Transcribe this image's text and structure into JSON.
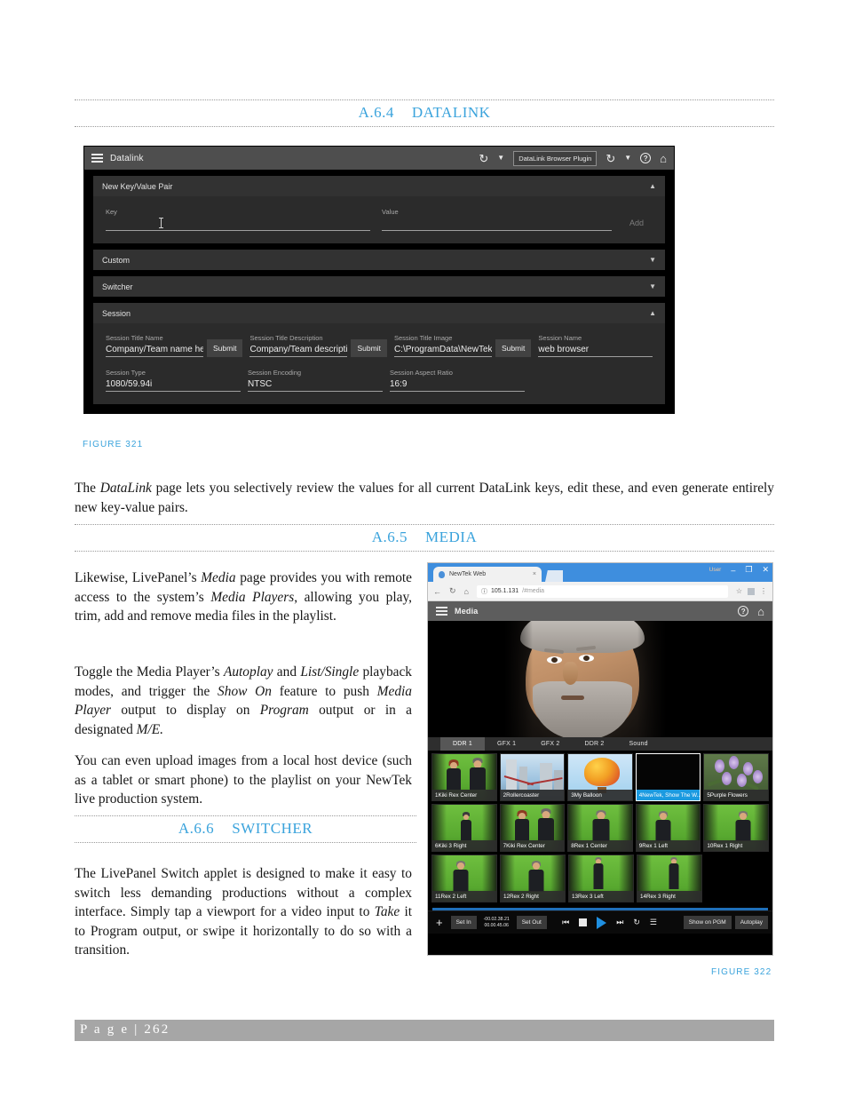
{
  "sections": {
    "datalink": {
      "num": "A.6.4",
      "title": "DATALINK"
    },
    "media": {
      "num": "A.6.5",
      "title": "MEDIA"
    },
    "switcher": {
      "num": "A.6.6",
      "title": "SWITCHER"
    }
  },
  "captions": {
    "figure321": "FIGURE 321",
    "figure322": "FIGURE 322"
  },
  "paragraphs": {
    "datalink_body_a": "The ",
    "datalink_body_em": "DataLink",
    "datalink_body_b": " page lets you selectively review the values for all current DataLink keys, edit these, and even generate entirely new key-value pairs.",
    "media_p1_a": "Likewise, LivePanel’s ",
    "media_p1_em1": "Media",
    "media_p1_b": " page provides you with remote access to the system’s ",
    "media_p1_em2": "Media Players",
    "media_p1_c": ", allowing you play, trim, add and remove media files in the playlist.",
    "media_p2_a": "Toggle the Media Player’s ",
    "media_p2_em1": "Autoplay",
    "media_p2_b": " and ",
    "media_p2_em2": "List/Single",
    "media_p2_c": " playback modes, and trigger the ",
    "media_p2_em3": "Show On",
    "media_p2_d": " feature to push ",
    "media_p2_em4": "Media Player",
    "media_p2_e": " output to display on ",
    "media_p2_em5": "Program",
    "media_p2_f": " output or in a designated ",
    "media_p2_em6": "M/E.",
    "media_p3": "You can even upload images from a local host device (such as a tablet or smart phone) to the playlist on your NewTek live production system.",
    "switcher_p1_a": "The LivePanel Switch applet is designed to make it easy to switch less demanding productions without a complex interface.  Simply tap a viewport for a video input to ",
    "switcher_p1_em": "Take",
    "switcher_p1_b": " it to Program output, or swipe it horizontally to do so with a transition."
  },
  "footer": {
    "page_label": "P a g e  |  262"
  },
  "datalink_app": {
    "menu_icon": "hamburger-icon",
    "title": "Datalink",
    "toolbar": {
      "refresh_left": "↻",
      "caret_left": "▼",
      "plugin_label": "DataLink Browser Plugin",
      "refresh_right": "↻",
      "caret_right": "▼",
      "help": "?",
      "home": "⌂"
    },
    "panels": [
      {
        "title": "New Key/Value Pair",
        "state": "expanded",
        "chevron": "▲"
      },
      {
        "title": "Custom",
        "state": "collapsed",
        "chevron": "▼"
      },
      {
        "title": "Switcher",
        "state": "collapsed",
        "chevron": "▼"
      },
      {
        "title": "Session",
        "state": "expanded",
        "chevron": "▲"
      }
    ],
    "new_pair": {
      "key_label": "Key",
      "key_value": "",
      "value_label": "Value",
      "value_value": "",
      "add_label": "Add"
    },
    "session_fields_row1": [
      {
        "label": "Session Title Name",
        "value": "Company/Team name her",
        "submit": "Submit"
      },
      {
        "label": "Session Title Description",
        "value": "Company/Team descripti",
        "submit": "Submit"
      },
      {
        "label": "Session Title Image",
        "value": "C:\\ProgramData\\NewTek\\",
        "submit": "Submit"
      },
      {
        "label": "Session Name",
        "value": "web browser",
        "submit": ""
      }
    ],
    "session_fields_row2": [
      {
        "label": "Session Type",
        "value": "1080/59.94i"
      },
      {
        "label": "Session Encoding",
        "value": "NTSC"
      },
      {
        "label": "Session Aspect Ratio",
        "value": "16:9"
      }
    ]
  },
  "media_app": {
    "browser": {
      "tab_title": "NewTek Web",
      "tab_close": "×",
      "user_label": "User",
      "minimize": "–",
      "maximize": "❐",
      "close": "✕",
      "back": "←",
      "reload": "↻",
      "home": "⌂",
      "url_info": "ⓘ",
      "url_host": "105.1.131",
      "url_path": "/#media",
      "star": "☆",
      "menu": "⋮"
    },
    "appbar": {
      "menu_icon": "hamburger-icon",
      "title": "Media",
      "help": "?",
      "home": "⌂"
    },
    "tabs": [
      {
        "label": "DDR 1",
        "active": true
      },
      {
        "label": "GFX 1",
        "active": false
      },
      {
        "label": "GFX 2",
        "active": false
      },
      {
        "label": "DDR 2",
        "active": false
      },
      {
        "label": "Sound",
        "active": false
      }
    ],
    "playlist": [
      [
        {
          "caption": "1Kiki Rex Center",
          "art": "green",
          "selected": false
        },
        {
          "caption": "2Rollercoaster",
          "art": "coaster",
          "selected": false
        },
        {
          "caption": "3My Balloon",
          "art": "balloon",
          "selected": false
        },
        {
          "caption": "4NewTek, Show The W...",
          "art": "black",
          "selected": true
        },
        {
          "caption": "5Purple Flowers",
          "art": "flowers",
          "selected": false
        }
      ],
      [
        {
          "caption": "6Kiki 3 Right",
          "art": "green",
          "selected": false
        },
        {
          "caption": "7Kiki Rex Center",
          "art": "green",
          "selected": false
        },
        {
          "caption": "8Rex 1 Center",
          "art": "green",
          "selected": false
        },
        {
          "caption": "9Rex 1 Left",
          "art": "green",
          "selected": false
        },
        {
          "caption": "10Rex 1 Right",
          "art": "green",
          "selected": false
        }
      ],
      [
        {
          "caption": "11Rex 2 Left",
          "art": "green",
          "selected": false
        },
        {
          "caption": "12Rex 2 Right",
          "art": "green",
          "selected": false
        },
        {
          "caption": "13Rex 3 Left",
          "art": "green",
          "selected": false
        },
        {
          "caption": "14Rex 3 Right",
          "art": "green",
          "selected": false
        }
      ]
    ],
    "transport": {
      "add": "+",
      "set_in": "Set In",
      "timecode_remaining": "-00.02.38.21",
      "timecode_elapsed": "00.00.45.06",
      "set_out": "Set Out",
      "prev": "⏮",
      "stop": "■",
      "play": "▶",
      "next": "⏭",
      "loop": "↻",
      "list": "☰",
      "show_on_pgm": "Show on PGM",
      "autoplay": "Autoplay"
    }
  },
  "colors": {
    "accent": "#3aa3dc",
    "selected_blue": "#1b9ae0",
    "app_dark": "#2b2b2b",
    "footer_gray": "#a6a6a6"
  }
}
